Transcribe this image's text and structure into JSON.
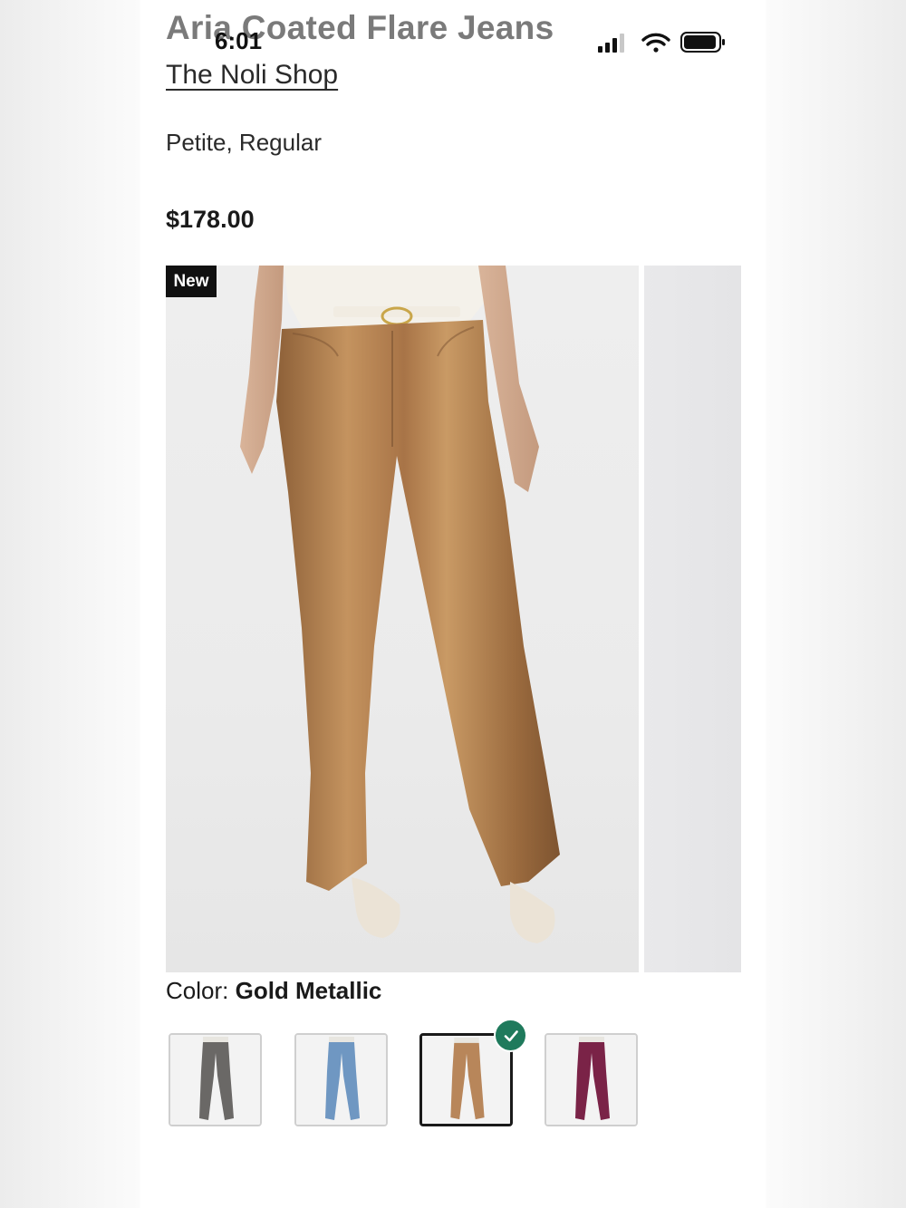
{
  "status_bar": {
    "time": "6:01",
    "icons": [
      "cellular-signal-icon",
      "wifi-icon",
      "battery-icon"
    ]
  },
  "product": {
    "title": "Aria Coated Flare Jeans",
    "brand": "The Noli Shop",
    "fits": "Petite, Regular",
    "price": "$178.00"
  },
  "gallery": {
    "badge": "New",
    "image_subject": "gold metallic flare pants on model"
  },
  "color": {
    "label": "Color:",
    "selected": "Gold Metallic",
    "swatches": [
      {
        "name": "charcoal-swatch",
        "color": "#6a6866"
      },
      {
        "name": "light-blue-swatch",
        "color": "#6f97c2"
      },
      {
        "name": "gold-metallic-swatch",
        "color": "#b8865a",
        "selected": true
      },
      {
        "name": "plum-swatch",
        "color": "#7a2347"
      }
    ],
    "check_color": "#1f7a5c"
  },
  "colors": {
    "title_gray": "#7a7a7a",
    "badge_bg": "#111111",
    "pants_gold": "#b8865a"
  }
}
